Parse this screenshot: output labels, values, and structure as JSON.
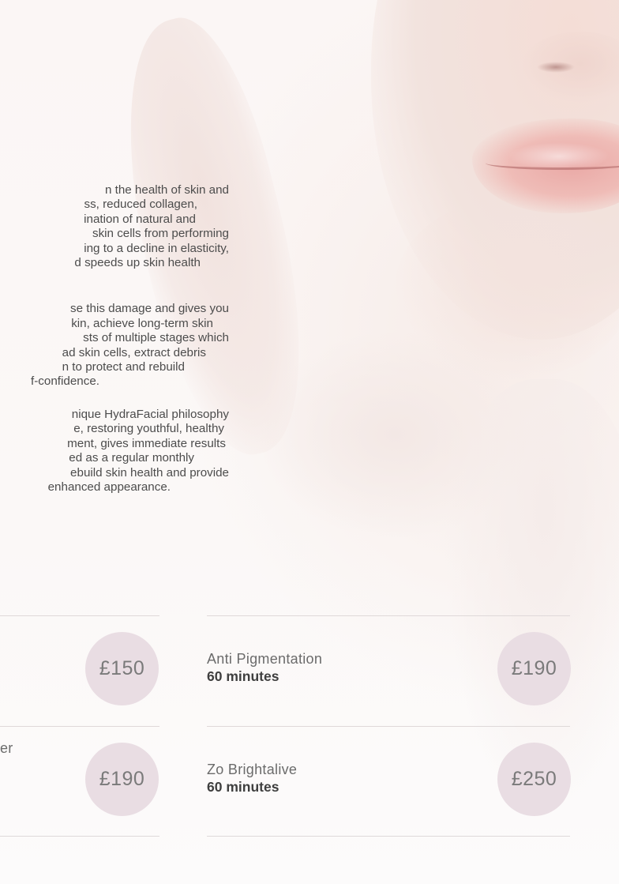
{
  "intro": {
    "paragraphs": [
      {
        "lines": [
          "n the health of skin and",
          "ss, reduced collagen,",
          "ination of natural and",
          " skin cells from performing",
          "ing to a decline in elasticity,",
          "d speeds up skin health"
        ]
      },
      {
        "lines": [
          "se this damage and gives you",
          "kin, achieve long-term skin",
          "sts of multiple stages which",
          "ad skin cells, extract debris",
          "n to protect and rebuild",
          "f-confidence."
        ]
      },
      {
        "lines": [
          "nique HydraFacial philosophy",
          "e, restoring youthful, healthy",
          "ment, gives immediate results",
          "ed as a regular monthly",
          "ebuild skin health and provide",
          " enhanced appearance."
        ]
      }
    ]
  },
  "treatments": [
    {
      "name": "",
      "duration": "",
      "price": "£150"
    },
    {
      "name": "Anti Pigmentation",
      "duration": "60 minutes",
      "price": "£190"
    },
    {
      "name": "er",
      "duration": "",
      "price": "£190"
    },
    {
      "name": "Zo Brightalive",
      "duration": "60 minutes",
      "price": "£250"
    }
  ],
  "colors": {
    "badge": "#e9dde3",
    "divider": "#dfd9d9",
    "text": "#4c4c4c"
  }
}
